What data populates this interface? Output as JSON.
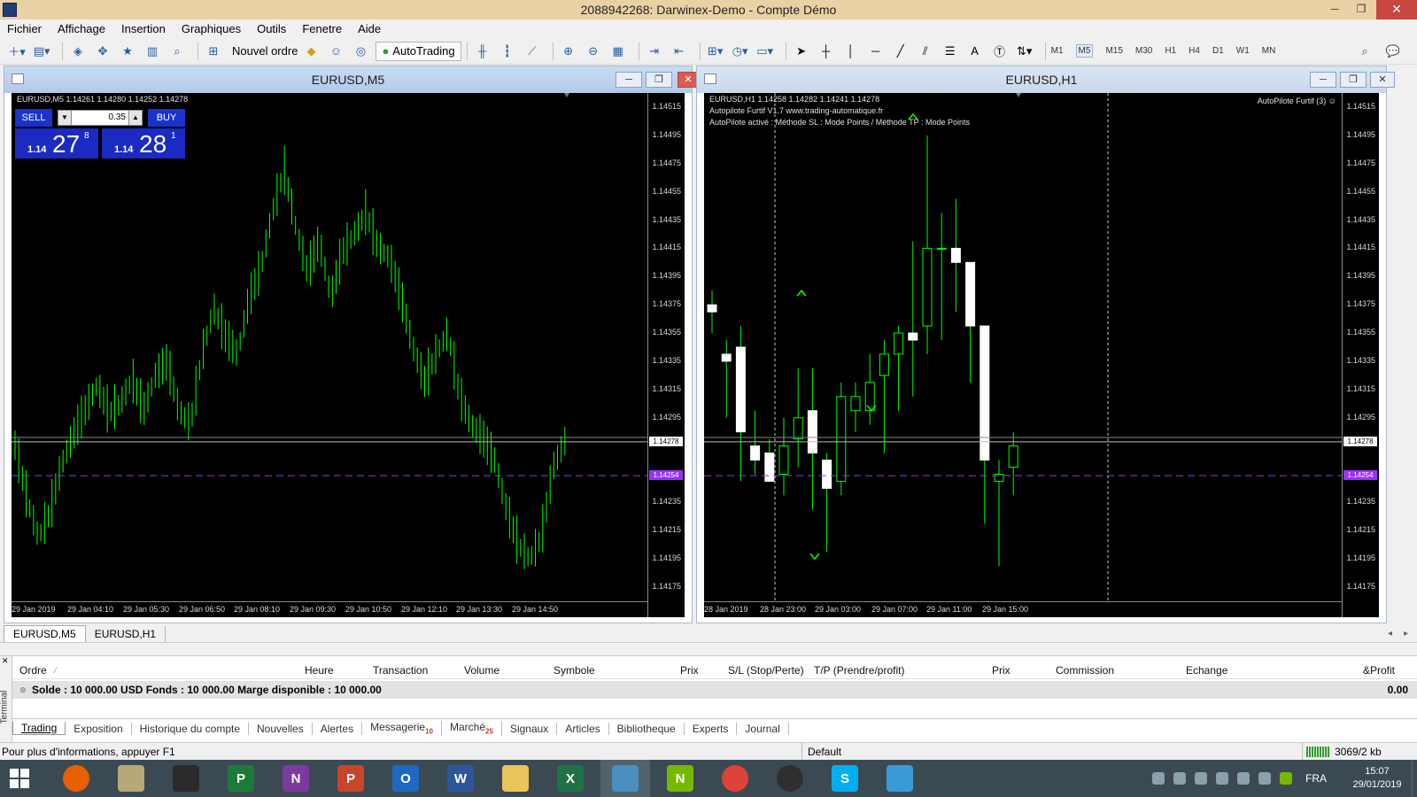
{
  "window": {
    "title": "2088942268: Darwinex-Demo - Compte Démo"
  },
  "menu": [
    "Fichier",
    "Affichage",
    "Insertion",
    "Graphiques",
    "Outils",
    "Fenetre",
    "Aide"
  ],
  "toolbar": {
    "new_order": "Nouvel ordre",
    "autotrading": "AutoTrading",
    "timeframes": [
      "M1",
      "M5",
      "M15",
      "M30",
      "H1",
      "H4",
      "D1",
      "W1",
      "MN"
    ],
    "active_timeframe": "M5",
    "text_tool": "A"
  },
  "chart_m5": {
    "window_title": "EURUSD,M5",
    "info": "EURUSD,M5  1.14261 1.14280 1.14252 1.14278",
    "one_click": {
      "sell": "SELL",
      "buy": "BUY",
      "lot": "0.35",
      "bid_prefix": "1.14",
      "bid_big": "27",
      "bid_sup": "8",
      "ask_prefix": "1.14",
      "ask_big": "28",
      "ask_sup": "1"
    },
    "price_ticks": [
      "1.14515",
      "1.14495",
      "1.14475",
      "1.14455",
      "1.14435",
      "1.14415",
      "1.14395",
      "1.14375",
      "1.14355",
      "1.14335",
      "1.14315",
      "1.14295",
      "1.14235",
      "1.14215",
      "1.14195",
      "1.14175"
    ],
    "current_price": "1.14278",
    "line_price": "1.14254",
    "time_labels": [
      "29 Jan 2019",
      "29 Jan 04:10",
      "29 Jan 05:30",
      "29 Jan 06:50",
      "29 Jan 08:10",
      "29 Jan 09:30",
      "29 Jan 10:50",
      "29 Jan 12:10",
      "29 Jan 13:30",
      "29 Jan 14:50"
    ]
  },
  "chart_h1": {
    "window_title": "EURUSD,H1",
    "info": "EURUSD,H1  1.14258 1.14282 1.14241 1.14278",
    "ea_line1": "Autopilote Furtif V1.7 www.trading-automatique.fr",
    "ea_line2": "AutoPilote activé : Méthode SL : Mode Points  / Méthode TP : Mode Points",
    "ea_label": "AutoPilote Furtif (3)",
    "price_ticks": [
      "1.14515",
      "1.14495",
      "1.14475",
      "1.14455",
      "1.14435",
      "1.14415",
      "1.14395",
      "1.14375",
      "1.14355",
      "1.14335",
      "1.14315",
      "1.14295",
      "1.14235",
      "1.14215",
      "1.14195",
      "1.14175"
    ],
    "current_price": "1.14278",
    "line_price": "1.14254",
    "time_labels": [
      "28 Jan 2019",
      "28 Jan 23:00",
      "29 Jan 03:00",
      "29 Jan 07:00",
      "29 Jan 11:00",
      "29 Jan 15:00"
    ]
  },
  "chart_tabs": [
    "EURUSD,M5",
    "EURUSD,H1"
  ],
  "terminal": {
    "side_label": "Terminal",
    "columns": [
      "Ordre",
      "Heure",
      "Transaction",
      "Volume",
      "Symbole",
      "Prix",
      "S/L (Stop/Perte)",
      "T/P (Prendre/profit)",
      "Prix",
      "Commission",
      "Echange",
      "&Profit"
    ],
    "summary": "Solde : 10 000.00 USD  Fonds : 10 000.00  Marge disponible : 10 000.00",
    "profit": "0.00",
    "tabs": [
      {
        "label": "Trading",
        "badge": ""
      },
      {
        "label": "Exposition",
        "badge": ""
      },
      {
        "label": "Historique du compte",
        "badge": ""
      },
      {
        "label": "Nouvelles",
        "badge": ""
      },
      {
        "label": "Alertes",
        "badge": ""
      },
      {
        "label": "Messagerie",
        "badge": "10"
      },
      {
        "label": "Marché",
        "badge": "25"
      },
      {
        "label": "Signaux",
        "badge": ""
      },
      {
        "label": "Articles",
        "badge": ""
      },
      {
        "label": "Bibliotheque",
        "badge": ""
      },
      {
        "label": "Experts",
        "badge": ""
      },
      {
        "label": "Journal",
        "badge": ""
      }
    ]
  },
  "status": {
    "help": "Pour plus d'informations, appuyer F1",
    "profile": "Default",
    "traffic": "3069/2 kb"
  },
  "taskbar": {
    "apps": [
      {
        "name": "firefox",
        "letter": "",
        "color": "#e66000"
      },
      {
        "name": "files",
        "letter": "",
        "color": "#b8a878"
      },
      {
        "name": "owl",
        "letter": "",
        "color": "#2a2a2a"
      },
      {
        "name": "publisher",
        "letter": "P",
        "color": "#1d7b3a"
      },
      {
        "name": "onenote",
        "letter": "N",
        "color": "#7b3aa0"
      },
      {
        "name": "powerpoint",
        "letter": "P",
        "color": "#c7462a"
      },
      {
        "name": "outlook",
        "letter": "O",
        "color": "#1f68c2"
      },
      {
        "name": "word",
        "letter": "W",
        "color": "#2b579a"
      },
      {
        "name": "explorer",
        "letter": "",
        "color": "#e8c45a"
      },
      {
        "name": "excel",
        "letter": "X",
        "color": "#1f7244"
      },
      {
        "name": "metatrader",
        "letter": "",
        "color": "#4a8fbf"
      },
      {
        "name": "nvidia",
        "letter": "N",
        "color": "#76b900"
      },
      {
        "name": "chrome",
        "letter": "",
        "color": "#db4437"
      },
      {
        "name": "obs",
        "letter": "",
        "color": "#302e31"
      },
      {
        "name": "skype",
        "letter": "S",
        "color": "#00aff0"
      },
      {
        "name": "monitor",
        "letter": "",
        "color": "#3a9bd9"
      }
    ],
    "language": "FRA",
    "time": "15:07",
    "date": "29/01/2019"
  },
  "colors": {
    "candle_up": "#00ff00",
    "chart_bg": "#000000",
    "line_price": "#9b30ff",
    "taskbar": "#3b4a52"
  }
}
